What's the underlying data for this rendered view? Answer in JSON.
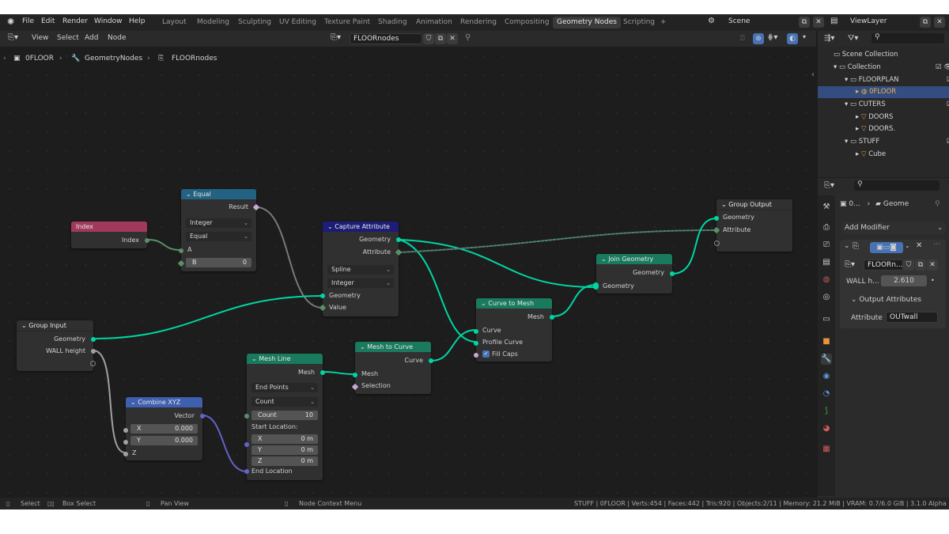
{
  "menu": {
    "file": "File",
    "edit": "Edit",
    "render": "Render",
    "window": "Window",
    "help": "Help",
    "workspaces": [
      "Layout",
      "Modeling",
      "Sculpting",
      "UV Editing",
      "Texture Paint",
      "Shading",
      "Animation",
      "Rendering",
      "Compositing",
      "Geometry Nodes",
      "Scripting"
    ],
    "add_workspace": "+",
    "scene": "Scene",
    "view_layer": "ViewLayer"
  },
  "editor_header": {
    "view": "View",
    "select": "Select",
    "add": "Add",
    "node": "Node",
    "node_group_name": "FLOORnodes"
  },
  "breadcrumb": {
    "object": "0FLOOR",
    "modifier": "GeometryNodes",
    "group": "FLOORnodes"
  },
  "nodes": {
    "index": {
      "title": "Index",
      "out": "Index"
    },
    "equal": {
      "title": "Equal",
      "out": "Result",
      "type": "Integer",
      "mode": "Equal",
      "a": "A",
      "b_label": "B",
      "b_value": "0"
    },
    "capture": {
      "title": "Capture Attribute",
      "out_geometry": "Geometry",
      "out_attribute": "Attribute",
      "domain": "Spline",
      "data_type": "Integer",
      "in_geometry": "Geometry",
      "in_value": "Value"
    },
    "group_output": {
      "title": "Group Output",
      "geometry": "Geometry",
      "attribute": "Attribute"
    },
    "join": {
      "title": "Join Geometry",
      "out": "Geometry",
      "in": "Geometry"
    },
    "curve_to_mesh": {
      "title": "Curve to Mesh",
      "out": "Mesh",
      "curve": "Curve",
      "profile": "Profile Curve",
      "fill_caps": "Fill Caps"
    },
    "mesh_to_curve": {
      "title": "Mesh to Curve",
      "out": "Curve",
      "mesh": "Mesh",
      "selection": "Selection"
    },
    "group_input": {
      "title": "Group Input",
      "geometry": "Geometry",
      "wall_height": "WALL height"
    },
    "combine_xyz": {
      "title": "Combine XYZ",
      "out": "Vector",
      "x_label": "X",
      "x_value": "0.000",
      "y_label": "Y",
      "y_value": "0.000",
      "z": "Z"
    },
    "mesh_line": {
      "title": "Mesh Line",
      "out": "Mesh",
      "mode": "End Points",
      "count_mode": "Count",
      "count_label": "Count",
      "count_value": "10",
      "start_location": "Start Location:",
      "x_label": "X",
      "x_value": "0 m",
      "y_label": "Y",
      "y_value": "0 m",
      "z_label": "Z",
      "z_value": "0 m",
      "end_location": "End Location"
    }
  },
  "status_bar": {
    "select": "Select",
    "box_select": "Box Select",
    "pan_view": "Pan View",
    "context_menu": "Node Context Menu",
    "stats": "STUFF | 0FLOOR | Verts:454 | Faces:442 | Tris:920 | Objects:2/11 | Memory: 21.2 MiB | VRAM: 0.7/6.0 GiB | 3.1.0 Alpha"
  },
  "outliner": {
    "scene_collection": "Scene Collection",
    "rows": [
      "Collection",
      "FLOORPLAN",
      "0FLOOR",
      "CUTERS",
      "DOORS",
      "DOORS.",
      "STUFF",
      "Cube"
    ]
  },
  "properties": {
    "object_short": "0...",
    "geometry_short": "Geome",
    "add_modifier": "Add Modifier",
    "node_group_short": "FLOORn...",
    "wall_label": "WALL h...",
    "wall_value": "2.610",
    "output_attributes": "Output Attributes",
    "attribute_label": "Attribute",
    "attribute_value": "OUTwall"
  },
  "colors": {
    "geometry_socket": "#00d6a3",
    "input_header": "#a1395b",
    "function_header": "#246283",
    "attribute_header": "#1d1d77",
    "geometry_header": "#1a7a5d",
    "vector_header": "#3f5fb0",
    "selection": "#334d80"
  }
}
